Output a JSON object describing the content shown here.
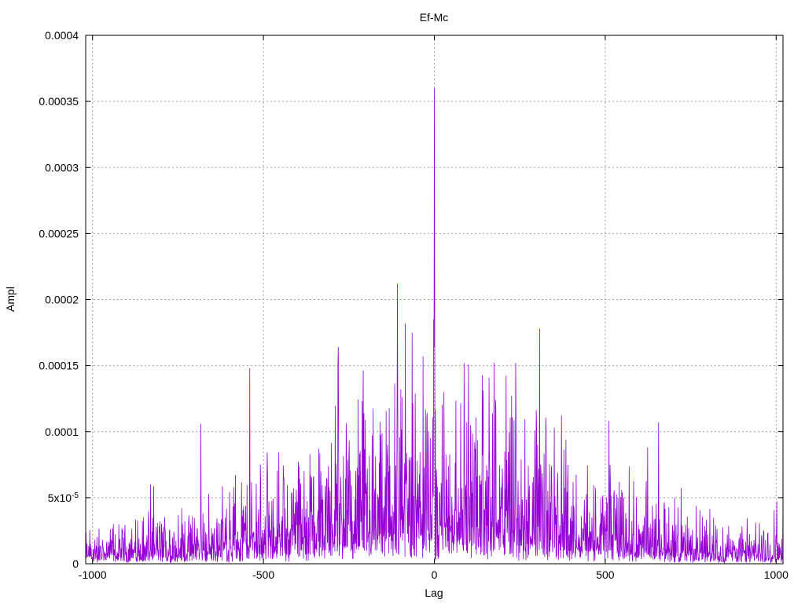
{
  "chart_data": {
    "type": "line",
    "title": "Ef-Mc",
    "xlabel": "Lag",
    "ylabel": "Ampl",
    "xlim": [
      -1020,
      1020
    ],
    "ylim": [
      0,
      0.0004
    ],
    "grid": true,
    "line_color": "#9400d3",
    "x_ticks": [
      {
        "value": -1000,
        "label": "-1000"
      },
      {
        "value": -500,
        "label": "-500"
      },
      {
        "value": 0,
        "label": "0"
      },
      {
        "value": 500,
        "label": "500"
      },
      {
        "value": 1000,
        "label": "1000"
      }
    ],
    "y_ticks": [
      {
        "value": 0,
        "label": "0"
      },
      {
        "value": 5e-05,
        "label": "5x10",
        "sup": "-5"
      },
      {
        "value": 0.0001,
        "label": "0.0001"
      },
      {
        "value": 0.00015,
        "label": "0.00015"
      },
      {
        "value": 0.0002,
        "label": "0.0002"
      },
      {
        "value": 0.00025,
        "label": "0.00025"
      },
      {
        "value": 0.0003,
        "label": "0.0003"
      },
      {
        "value": 0.00035,
        "label": "0.00035"
      },
      {
        "value": 0.0004,
        "label": "0.0004"
      }
    ],
    "series": [
      {
        "x_start": -1020,
        "x_end": 1020,
        "sample_step": 1,
        "peaks": [
          {
            "x": 0,
            "y": 0.00036
          },
          {
            "x": 1,
            "y": 0.000205
          },
          {
            "x": -2,
            "y": 0.000185
          },
          {
            "x": -108,
            "y": 0.000212
          },
          {
            "x": 308,
            "y": 0.000178
          },
          {
            "x": -540,
            "y": 0.000148
          },
          {
            "x": -85,
            "y": 0.000182
          },
          {
            "x": -65,
            "y": 0.000175
          },
          {
            "x": -282,
            "y": 0.000152
          },
          {
            "x": 175,
            "y": 0.000152
          },
          {
            "x": 238,
            "y": 0.000152
          },
          {
            "x": 656,
            "y": 0.000107
          },
          {
            "x": -683,
            "y": 0.000106
          },
          {
            "x": -830,
            "y": 6e-05
          },
          {
            "x": 1020,
            "y": 5e-05
          }
        ]
      }
    ]
  }
}
